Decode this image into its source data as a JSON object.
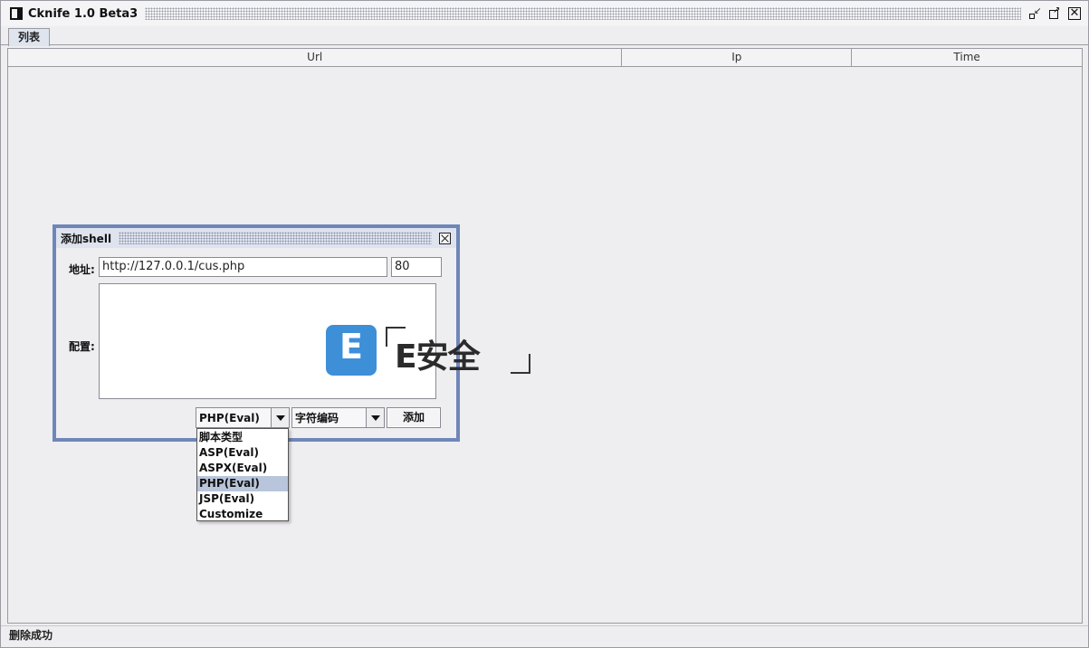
{
  "window": {
    "title": "Cknife 1.0 Beta3"
  },
  "tabs": [
    {
      "label": "列表",
      "active": true
    }
  ],
  "table": {
    "columns": [
      "Url",
      "Ip",
      "Time"
    ],
    "rows": []
  },
  "status": {
    "text": "删除成功"
  },
  "dialog": {
    "title": "添加shell",
    "address_label": "地址:",
    "url_value": "http://127.0.0.1/cus.php",
    "password_value": "80",
    "config_label": "配置:",
    "config_value": "",
    "script_type_selected": "PHP(Eval)",
    "encoding_selected": "字符编码",
    "add_button": "添加"
  },
  "dropdown": {
    "items": [
      "脚本类型",
      "ASP(Eval)",
      "ASPX(Eval)",
      "PHP(Eval)",
      "JSP(Eval)",
      "Customize"
    ],
    "highlighted": "PHP(Eval)"
  },
  "watermark": {
    "icon_letter": "E",
    "text": "E安全"
  },
  "colors": {
    "dialog_border": "#6f86b8",
    "highlight": "#b9c5da",
    "watermark_icon": "#3d8fd8",
    "window_bg": "#eeedf0"
  }
}
